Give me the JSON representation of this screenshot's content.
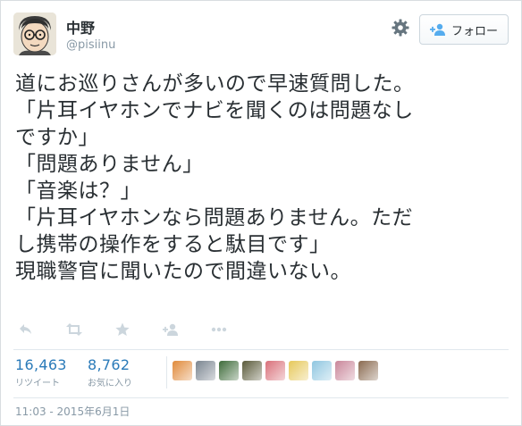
{
  "user": {
    "display_name": "中野",
    "handle": "@pisiinu",
    "avatar_icon": "cartoon-avatar-icon"
  },
  "header": {
    "settings_icon": "gear-icon",
    "follow_icon": "add-user-icon",
    "follow_label": "フォロー"
  },
  "tweet": {
    "text": "道にお巡りさんが多いので早速質問した。\n「片耳イヤホンでナビを聞くのは問題なし\nですか」\n「問題ありません」\n「音楽は？」\n「片耳イヤホンなら問題ありません。ただ\nし携帯の操作をすると駄目です」\n現職警官に聞いたので間違いない。"
  },
  "actions": [
    {
      "name": "reply-icon"
    },
    {
      "name": "retweet-icon"
    },
    {
      "name": "favorite-icon"
    },
    {
      "name": "follow-user-icon"
    },
    {
      "name": "more-icon"
    }
  ],
  "stats": {
    "retweets": {
      "count": "16,463",
      "label": "リツイート"
    },
    "likes": {
      "count": "8,762",
      "label": "お気に入り"
    }
  },
  "likers": [
    "#e08a3a",
    "#7a8590",
    "#3e6b3a",
    "#5a5a3a",
    "#d9707a",
    "#e6c85a",
    "#8fc6e0",
    "#c9869a",
    "#8a6a50"
  ],
  "timestamp": "11:03 - 2015年6月1日"
}
